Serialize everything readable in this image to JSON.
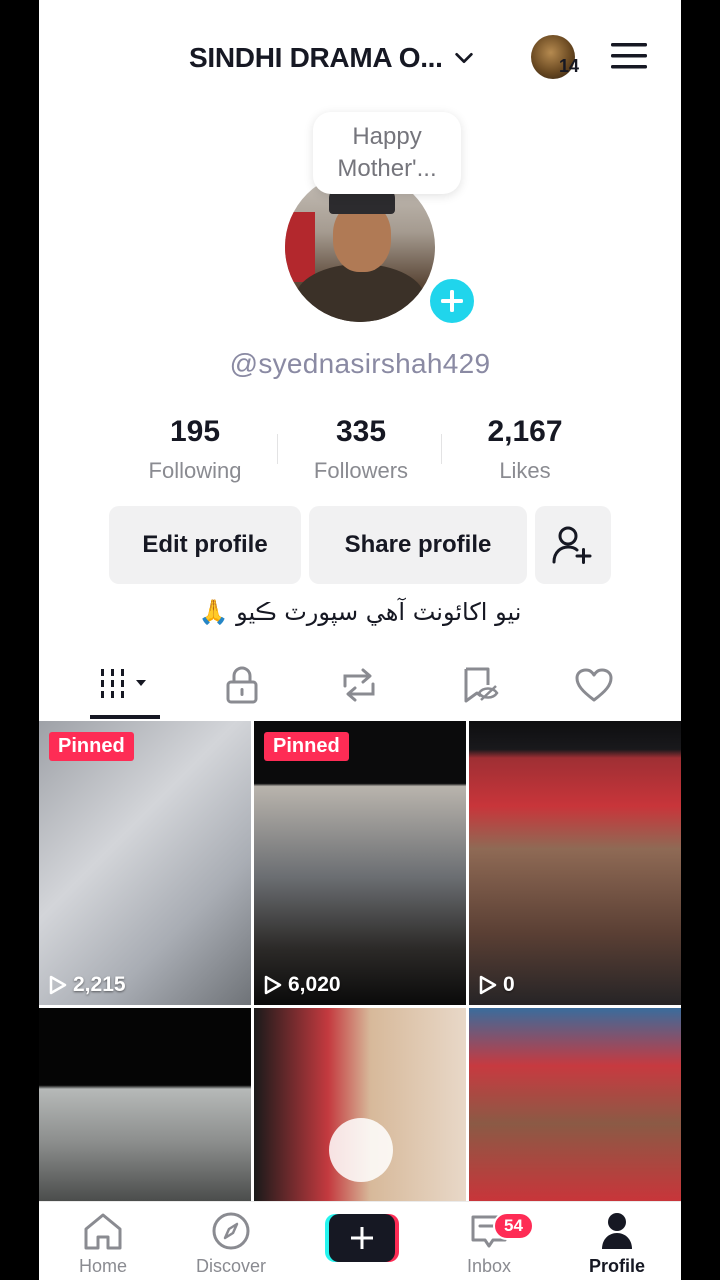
{
  "header": {
    "account_title": "SINDHI DRAMA O...",
    "notification_count": "14"
  },
  "note": {
    "line1": "Happy",
    "line2": "Mother'..."
  },
  "profile": {
    "username": "@syednasirshah429",
    "stats": [
      {
        "value": "195",
        "label": "Following"
      },
      {
        "value": "335",
        "label": "Followers"
      },
      {
        "value": "2,167",
        "label": "Likes"
      }
    ],
    "buttons": {
      "edit": "Edit profile",
      "share": "Share profile"
    },
    "bio": "نيو اکائونٽ آهي سپورٽ ڪيو 🙏"
  },
  "tabs": [
    "videos-grid",
    "private",
    "reposts",
    "favorites",
    "liked"
  ],
  "videos": [
    {
      "pinned": "Pinned",
      "views": "2,215"
    },
    {
      "pinned": "Pinned",
      "views": "6,020"
    },
    {
      "pinned": "",
      "views": "0"
    },
    {
      "pinned": "",
      "views": ""
    },
    {
      "pinned": "",
      "views": ""
    },
    {
      "pinned": "",
      "views": ""
    }
  ],
  "bottom_nav": {
    "home": "Home",
    "discover": "Discover",
    "inbox": "Inbox",
    "inbox_badge": "54",
    "profile": "Profile"
  },
  "colors": {
    "accent": "#fe2c55",
    "cyan": "#20d5ec",
    "text": "#161823",
    "muted": "#8a8b91"
  }
}
